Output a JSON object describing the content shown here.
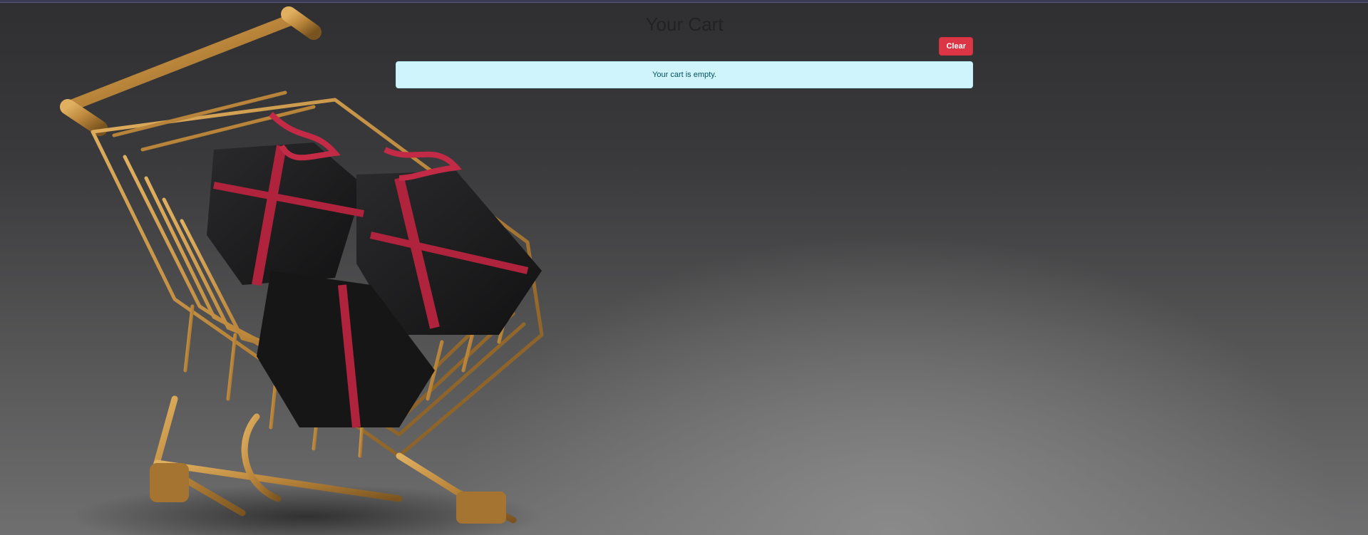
{
  "cart": {
    "title": "Your Cart",
    "clear_label": "Clear",
    "empty_message": "Your cart is empty."
  },
  "background": {
    "image": "shopping-cart-with-gift-boxes",
    "colors": {
      "backdrop": "#3a3a3c",
      "cart_gold": "#b8843a",
      "gift_black": "#1c1c1e",
      "ribbon": "#b0233d"
    }
  },
  "colors": {
    "danger": "#dc3545",
    "info_bg": "#cff4fc",
    "info_text": "#055160"
  }
}
